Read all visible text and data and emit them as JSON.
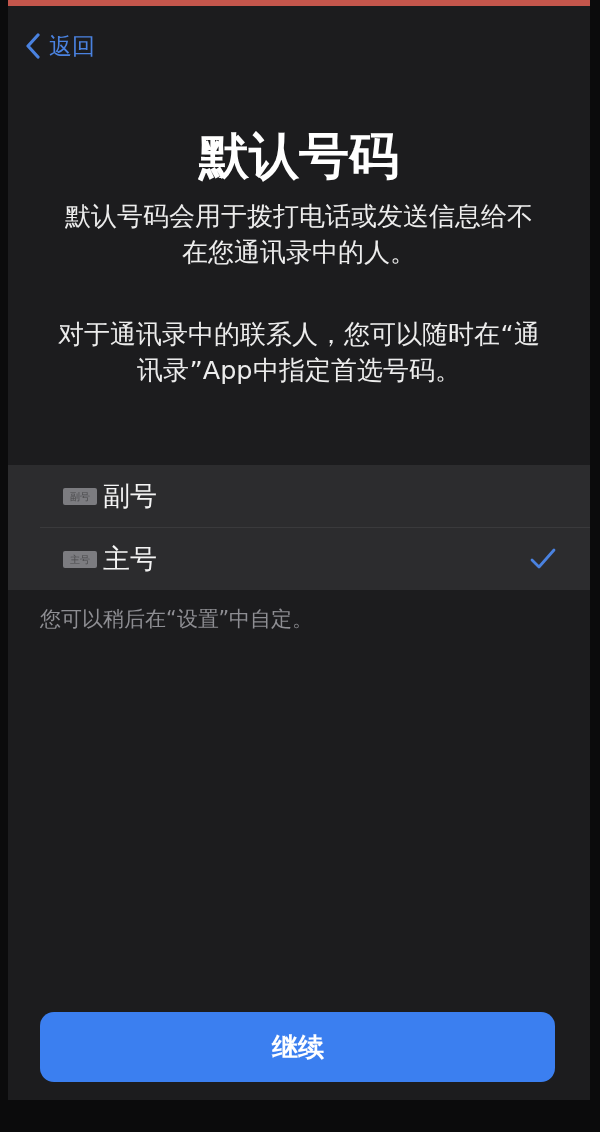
{
  "nav": {
    "back_label": "返回"
  },
  "title": "默认号码",
  "paragraphs": [
    "默认号码会用于拨打电话或发送信息给不在您通讯录中的人。",
    "对于通讯录中的联系人，您可以随时在“通讯录”App中指定首选号码。"
  ],
  "options": [
    {
      "badge": "副号",
      "label": "副号",
      "selected": false
    },
    {
      "badge": "主号",
      "label": "主号",
      "selected": true
    }
  ],
  "footnote": "您可以稍后在“设置”中自定。",
  "continue_button": "继续"
}
